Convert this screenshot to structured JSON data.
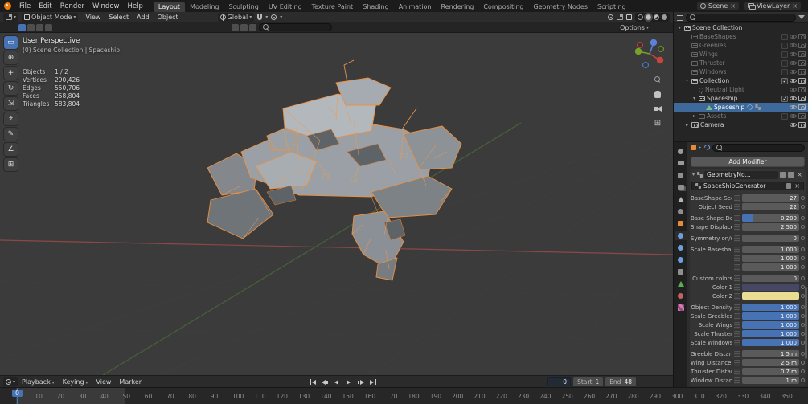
{
  "icons": {
    "chevron_down": "▾",
    "chevron_right": "▸",
    "close": "×",
    "grid": "⊞"
  },
  "topbar": {
    "menus": [
      "File",
      "Edit",
      "Render",
      "Window",
      "Help"
    ],
    "workspaces": [
      "Layout",
      "Modeling",
      "Sculpting",
      "UV Editing",
      "Texture Paint",
      "Shading",
      "Animation",
      "Rendering",
      "Compositing",
      "Geometry Nodes",
      "Scripting"
    ],
    "active_workspace": "Layout",
    "scene_name": "Scene",
    "view_layer_name": "ViewLayer"
  },
  "viewport_header": {
    "mode": "Object Mode",
    "menus": [
      "View",
      "Select",
      "Add",
      "Object"
    ],
    "orientation": "Global",
    "options_label": "Options"
  },
  "viewport": {
    "title": "User Perspective",
    "context": "(0) Scene Collection | Spaceship",
    "stats": [
      {
        "label": "Objects",
        "value": "1 / 2"
      },
      {
        "label": "Vertices",
        "value": "290,426"
      },
      {
        "label": "Edges",
        "value": "550,706"
      },
      {
        "label": "Faces",
        "value": "258,804"
      },
      {
        "label": "Triangles",
        "value": "583,804"
      }
    ],
    "tools": [
      {
        "name": "select-box-tool",
        "glyph": "▭",
        "active": true
      },
      {
        "name": "cursor-tool",
        "glyph": "⊕"
      },
      {
        "name": "move-tool",
        "glyph": "+"
      },
      {
        "name": "rotate-tool",
        "glyph": "↻"
      },
      {
        "name": "scale-tool",
        "glyph": "⇲"
      },
      {
        "name": "transform-tool",
        "glyph": "⌖"
      },
      {
        "name": "annotate-tool",
        "glyph": "✎"
      },
      {
        "name": "measure-tool",
        "glyph": "∠"
      },
      {
        "name": "add-cube-tool",
        "glyph": "⊞"
      }
    ]
  },
  "outliner": {
    "rows": [
      {
        "label": "Scene Collection",
        "indent": 0,
        "icon": "collection",
        "expanded": true,
        "toggles": []
      },
      {
        "label": "BaseShapes",
        "indent": 1,
        "icon": "collection",
        "dim": true,
        "toggles": [
          "box",
          "eye",
          "cam"
        ]
      },
      {
        "label": "Greebles",
        "indent": 1,
        "icon": "collection",
        "dim": true,
        "toggles": [
          "box",
          "eye",
          "cam"
        ]
      },
      {
        "label": "Wings",
        "indent": 1,
        "icon": "collection",
        "dim": true,
        "toggles": [
          "box",
          "eye",
          "cam"
        ]
      },
      {
        "label": "Thruster",
        "indent": 1,
        "icon": "collection",
        "dim": true,
        "toggles": [
          "box",
          "eye",
          "cam"
        ]
      },
      {
        "label": "Windows",
        "indent": 1,
        "icon": "collection",
        "dim": true,
        "toggles": [
          "box",
          "eye",
          "cam"
        ]
      },
      {
        "label": "Collection",
        "indent": 1,
        "icon": "collection",
        "expanded": true,
        "toggles": [
          "check",
          "eye",
          "cam"
        ]
      },
      {
        "label": "Neutral Light",
        "indent": 2,
        "icon": "light",
        "dim": true,
        "toggles": [
          "eye",
          "cam"
        ]
      },
      {
        "label": "Spaceship",
        "indent": 2,
        "icon": "collection",
        "expanded": true,
        "toggles": [
          "check",
          "eye",
          "cam"
        ]
      },
      {
        "label": "Spaceship",
        "indent": 3,
        "icon": "mesh",
        "selected": true,
        "extra": [
          "wrench",
          "nodes"
        ],
        "toggles": [
          "eye",
          "cam"
        ]
      },
      {
        "label": "Assets",
        "indent": 2,
        "icon": "collection",
        "dim": true,
        "expanded": false,
        "toggles": [
          "box",
          "eye",
          "cam"
        ]
      },
      {
        "label": "Camera",
        "indent": 1,
        "icon": "camera",
        "expanded": false,
        "toggles": [
          "eye",
          "cam"
        ]
      }
    ]
  },
  "properties": {
    "add_modifier_label": "Add Modifier",
    "modifier_name": "GeometryNo...",
    "node_group_name": "SpaceShipGenerator",
    "tabs": [
      {
        "name": "tool",
        "shape": "circle",
        "color": "#9a9a9a"
      },
      {
        "name": "render",
        "shape": "camera",
        "color": "#9a9a9a"
      },
      {
        "name": "output",
        "shape": "square",
        "color": "#8f8f8f"
      },
      {
        "name": "view-layer",
        "shape": "layers",
        "color": "#8f8f8f"
      },
      {
        "name": "scene",
        "shape": "triangle",
        "color": "#b5b5b5"
      },
      {
        "name": "world",
        "shape": "circle",
        "color": "#8f8f8f"
      },
      {
        "name": "object",
        "shape": "square",
        "color": "#e78a3a"
      },
      {
        "name": "modifier",
        "shape": "circle",
        "color": "#6ca0dd",
        "active": true
      },
      {
        "name": "particles",
        "shape": "circle",
        "color": "#6ca0dd"
      },
      {
        "name": "physics",
        "shape": "circle",
        "color": "#6ca0dd"
      },
      {
        "name": "constraints",
        "shape": "square",
        "color": "#8f8f8f"
      },
      {
        "name": "data",
        "shape": "triangle",
        "color": "#55b055"
      },
      {
        "name": "material",
        "shape": "circle",
        "color": "#c46262"
      },
      {
        "name": "texture",
        "shape": "checker",
        "color": "#d977b8"
      }
    ],
    "fields": [
      {
        "label": "BaseShape Seed",
        "value": "27",
        "fill": 0
      },
      {
        "label": "Object Seed",
        "value": "22",
        "fill": 0
      },
      {
        "label": "Base Shape Den...",
        "value": "0.200",
        "fill": 0.2,
        "gap_before": true
      },
      {
        "label": "Shape Displace...",
        "value": "2.500",
        "fill": 0
      },
      {
        "label": "Symmetry on/off",
        "value": "0",
        "fill": 0,
        "gap_before": true
      },
      {
        "label": "Scale Baseshape...",
        "value": "1.000",
        "fill": 0,
        "gap_before": true
      },
      {
        "label": "",
        "value": "1.000",
        "fill": 0
      },
      {
        "label": "",
        "value": "1.000",
        "fill": 0
      },
      {
        "label": "Custom colors",
        "value": "0",
        "fill": 0,
        "gap_before": true
      },
      {
        "label": "Color 1",
        "swatch": "#464764"
      },
      {
        "label": "Color 2",
        "swatch": "#e9dc93"
      },
      {
        "label": "Object Density",
        "value": "1.000",
        "fill": 1,
        "gap_before": true
      },
      {
        "label": "Scale Greebles",
        "value": "1.000",
        "fill": 1
      },
      {
        "label": "Scale Wings",
        "value": "1.000",
        "fill": 1
      },
      {
        "label": "Scale Thuster",
        "value": "1.000",
        "fill": 1
      },
      {
        "label": "Scale Windows",
        "value": "1.000",
        "fill": 1
      },
      {
        "label": "Greeble Distanc...",
        "value": "1.5 m",
        "fill": 0,
        "gap_before": true
      },
      {
        "label": "Wing Distance Min",
        "value": "2.5 m",
        "fill": 0
      },
      {
        "label": "Thruster Distanc...",
        "value": "0.7 m",
        "fill": 0
      },
      {
        "label": "Window Distanc...",
        "value": "1 m",
        "fill": 0
      }
    ]
  },
  "timeline": {
    "menus": [
      {
        "label": "Playback",
        "chev": true
      },
      {
        "label": "Keying",
        "chev": true
      },
      {
        "label": "View"
      },
      {
        "label": "Marker"
      }
    ],
    "current_frame": "0",
    "start_label": "Start",
    "start_value": "1",
    "end_label": "End",
    "end_value": "48",
    "frame_range": {
      "start": 1,
      "end": 48
    },
    "ticks": [
      10,
      20,
      30,
      40,
      50,
      60,
      70,
      80,
      90,
      100,
      110,
      120,
      130,
      140,
      150,
      160,
      170,
      180,
      190,
      200,
      210,
      220,
      230,
      240,
      250,
      260,
      270,
      280,
      290,
      300,
      310,
      320,
      330,
      340,
      350
    ]
  },
  "colors": {
    "accent": "#4772b3",
    "selection_orange": "#e87d0d",
    "wire_orange": "#ef9a4f"
  }
}
